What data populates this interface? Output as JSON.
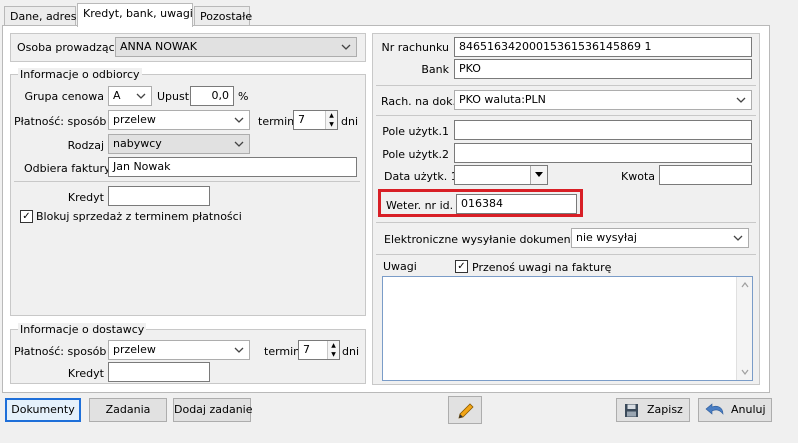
{
  "tabs": [
    {
      "label": "Dane, adres"
    },
    {
      "label": "Kredyt, bank, uwagi"
    },
    {
      "label": "Pozostałe"
    }
  ],
  "left": {
    "seller_label": "Osoba prowadząca",
    "seller_value": "ANNA NOWAK",
    "recipient_group": "Informacje o odbiorcy",
    "price_group_label": "Grupa cenowa",
    "price_group_value": "A",
    "discount_label": "Upust",
    "discount_value": "0,0",
    "percent_sign": "%",
    "payment_label": "Płatność: sposób",
    "payment_value": "przelew",
    "term_label": "termin",
    "term_value": "7",
    "days_label": "dni",
    "type_label": "Rodzaj",
    "type_value": "nabywcy",
    "receiver_label": "Odbiera faktury",
    "receiver_value": "Jan Nowak",
    "credit_label": "Kredyt",
    "credit_value": "",
    "block_sale_label": "Blokuj sprzedaż z terminem płatności",
    "block_sale_checked": true,
    "supplier_group": "Informacje o dostawcy",
    "supplier_payment_label": "Płatność: sposób",
    "supplier_payment_value": "przelew",
    "supplier_term_label": "termin",
    "supplier_term_value": "7",
    "supplier_days_label": "dni",
    "supplier_credit_label": "Kredyt",
    "supplier_credit_value": ""
  },
  "right": {
    "account_label": "Nr rachunku",
    "account_value": "84651634200015361536145869 1",
    "bank_label": "Bank",
    "bank_value": "PKO",
    "acc_on_doc_label": "Rach. na dok.",
    "acc_on_doc_value": "PKO waluta:PLN",
    "user_field1_label": "Pole użytk.1",
    "user_field1_value": "",
    "user_field2_label": "Pole użytk.2",
    "user_field2_value": "",
    "user_date_label": "Data użytk. 1",
    "user_date_value": "",
    "amount_label": "Kwota",
    "amount_value": "",
    "vet_label": "Weter. nr id.",
    "vet_value": "016384",
    "edoc_label": "Elektroniczne wysyłanie dokumentów",
    "edoc_value": "nie wysyłaj",
    "notes_label": "Uwagi",
    "transfer_notes_label": "Przenoś uwagi na fakturę",
    "transfer_notes_checked": true,
    "notes_value": ""
  },
  "buttons": {
    "documents": "Dokumenty",
    "tasks": "Zadania",
    "add_task": "Dodaj zadanie",
    "save": "Zapisz",
    "cancel": "Anuluj"
  },
  "colors": {
    "highlight": "#d81f26",
    "focus": "#1e6fd9"
  }
}
